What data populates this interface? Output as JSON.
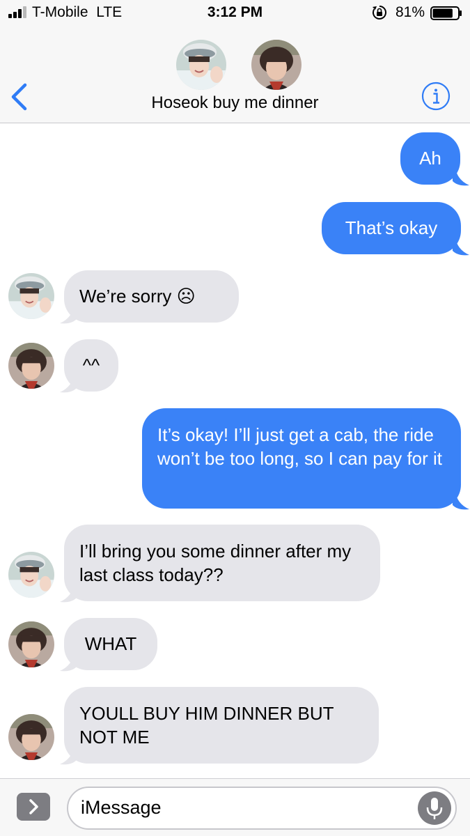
{
  "status": {
    "carrier": "T-Mobile  LTE",
    "time": "3:12 PM",
    "battery": "81%",
    "battery_level": 0.81,
    "signal_bars": 3
  },
  "header": {
    "title": "Hoseok buy me dinner",
    "accent_color": "#2f7cf6"
  },
  "messages": [
    {
      "from": "me",
      "text": "Ah"
    },
    {
      "from": "me",
      "text": "That’s okay"
    },
    {
      "from": "hoseok",
      "text": "We’re sorry ☹"
    },
    {
      "from": "taehyung",
      "text": "^^"
    },
    {
      "from": "me",
      "text": "It’s okay! I’ll just get a cab, the ride won’t be too long, so I can pay for it"
    },
    {
      "from": "hoseok",
      "text": "I’ll bring you some dinner after my last class today??"
    },
    {
      "from": "taehyung",
      "text": "WHAT"
    },
    {
      "from": "taehyung",
      "text": "YOULL BUY HIM DINNER BUT NOT ME"
    }
  ],
  "composer": {
    "placeholder": "iMessage"
  },
  "colors": {
    "sent_bubble": "#3a82f7",
    "received_bubble": "#e5e5ea"
  }
}
